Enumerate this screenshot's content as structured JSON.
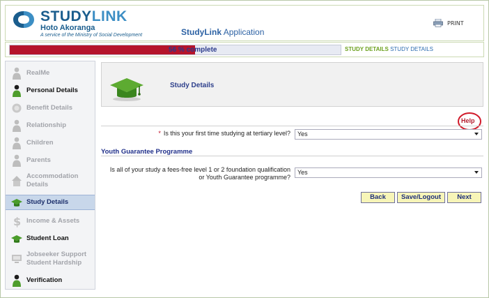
{
  "header": {
    "logo_study": "STUDY",
    "logo_link": "LINK",
    "logo_subtitle": "Hoto Akoranga",
    "logo_tagline": "A service of the Ministry of Social Development",
    "app_title_bold": "StudyLink",
    "app_title_rest": " Application",
    "print_label": "PRINT",
    "print_icon": "printer-icon"
  },
  "progress": {
    "percent": 56,
    "label": "56 % complete",
    "fill_color": "#b5152b",
    "breadcrumb_current": "STUDY DETAILS",
    "breadcrumb_next": "STUDY DETAILS"
  },
  "sidebar": {
    "items": [
      {
        "label": "RealMe",
        "icon": "person-icon",
        "state": "disabled"
      },
      {
        "label": "Personal Details",
        "icon": "person-icon",
        "state": "complete"
      },
      {
        "label": "Benefit Details",
        "icon": "coin-icon",
        "state": "disabled"
      },
      {
        "label": "Relationship",
        "icon": "person-icon",
        "state": "disabled"
      },
      {
        "label": "Children",
        "icon": "person-icon",
        "state": "disabled"
      },
      {
        "label": "Parents",
        "icon": "person-icon",
        "state": "disabled"
      },
      {
        "label": "Accommodation Details",
        "icon": "house-icon",
        "state": "disabled"
      },
      {
        "label": "Study Details",
        "icon": "graduation-cap-icon",
        "state": "current"
      },
      {
        "label": "Income & Assets",
        "icon": "dollar-icon",
        "state": "disabled"
      },
      {
        "label": "Student Loan",
        "icon": "graduation-cap-icon",
        "state": "complete"
      },
      {
        "label": "Jobseeker Support Student Hardship",
        "icon": "computer-icon",
        "state": "disabled"
      },
      {
        "label": "Verification",
        "icon": "person-icon",
        "state": "complete"
      }
    ]
  },
  "main": {
    "section_title": "Study Details",
    "section_icon": "graduation-cap-icon",
    "help_label": "Help",
    "question1": {
      "required_mark": "*",
      "label": "Is this your first time studying at tertiary level?",
      "value": "Yes"
    },
    "subheading": "Youth Guarantee Programme",
    "question2": {
      "label_line1": "Is all of your study a fees-free level 1 or 2 foundation qualification",
      "label_line2": "or Youth Guarantee programme?",
      "value": "Yes"
    },
    "buttons": {
      "back": "Back",
      "save_logout": "Save/Logout",
      "next": "Next"
    }
  },
  "colors": {
    "accent_green": "#6ca11e",
    "brand_blue": "#1a5d8d",
    "button_fill": "#f7f5b8",
    "help_red": "#b31b2d"
  }
}
